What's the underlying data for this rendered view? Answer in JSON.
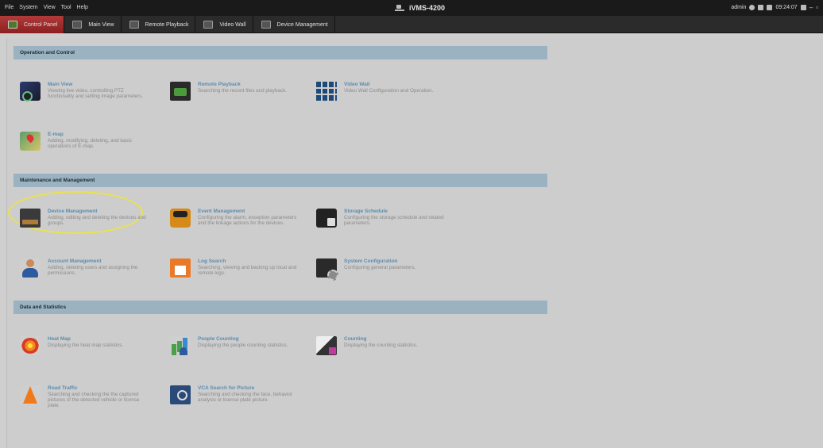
{
  "menu": [
    "File",
    "System",
    "View",
    "Tool",
    "Help"
  ],
  "app_title": "iVMS-4200",
  "status": {
    "user": "admin",
    "time": "09:24:07"
  },
  "window_controls": {
    "minimize": "–",
    "restore": "▫"
  },
  "tabs": [
    {
      "label": "Control Panel",
      "active": true
    },
    {
      "label": "Main View",
      "active": false
    },
    {
      "label": "Remote Playback",
      "active": false
    },
    {
      "label": "Video Wall",
      "active": false
    },
    {
      "label": "Device Management",
      "active": false
    }
  ],
  "sections": [
    {
      "title": "Operation and Control",
      "items": [
        {
          "title": "Main View",
          "desc": "Viewing live video, controlling PTZ functionality and setting image parameters.",
          "icon": "main-view-icon"
        },
        {
          "title": "Remote Playback",
          "desc": "Searching the record files and playback.",
          "icon": "remote-playback-icon"
        },
        {
          "title": "Video Wall",
          "desc": "Video Wall Configuration and Operation.",
          "icon": "video-wall-icon"
        },
        {
          "title": "E-map",
          "desc": "Adding, modifying, deleting, and basic operations of E-map.",
          "icon": "emap-icon"
        }
      ]
    },
    {
      "title": "Maintenance and Management",
      "items": [
        {
          "title": "Device Management",
          "desc": "Adding, editing and deleting the devices and groups.",
          "icon": "device-management-icon"
        },
        {
          "title": "Event Management",
          "desc": "Configuring the alarm, exception parameters and the linkage actions for the devices.",
          "icon": "event-management-icon"
        },
        {
          "title": "Storage Schedule",
          "desc": "Configuring the storage schedule and related parameters.",
          "icon": "storage-schedule-icon"
        },
        {
          "title": "Account Management",
          "desc": "Adding, deleting users and assigning the permissions.",
          "icon": "account-management-icon"
        },
        {
          "title": "Log Search",
          "desc": "Searching, viewing and backing up local and remote logs.",
          "icon": "log-search-icon"
        },
        {
          "title": "System Configuration",
          "desc": "Configuring general parameters.",
          "icon": "system-configuration-icon"
        }
      ]
    },
    {
      "title": "Data and Statistics",
      "items": [
        {
          "title": "Heat Map",
          "desc": "Displaying the heat map statistics.",
          "icon": "heat-map-icon"
        },
        {
          "title": "People Counting",
          "desc": "Displaying the people counting statistics.",
          "icon": "people-counting-icon"
        },
        {
          "title": "Counting",
          "desc": "Displaying the counting statistics.",
          "icon": "counting-icon"
        },
        {
          "title": "Road Traffic",
          "desc": "Searching and checking the the captured pictures of the detected vehicle or license plate.",
          "icon": "road-traffic-icon"
        },
        {
          "title": "VCA Search for Picture",
          "desc": "Searching and checking the face, behavior analysis or license plate picture.",
          "icon": "vca-search-icon"
        }
      ]
    }
  ]
}
